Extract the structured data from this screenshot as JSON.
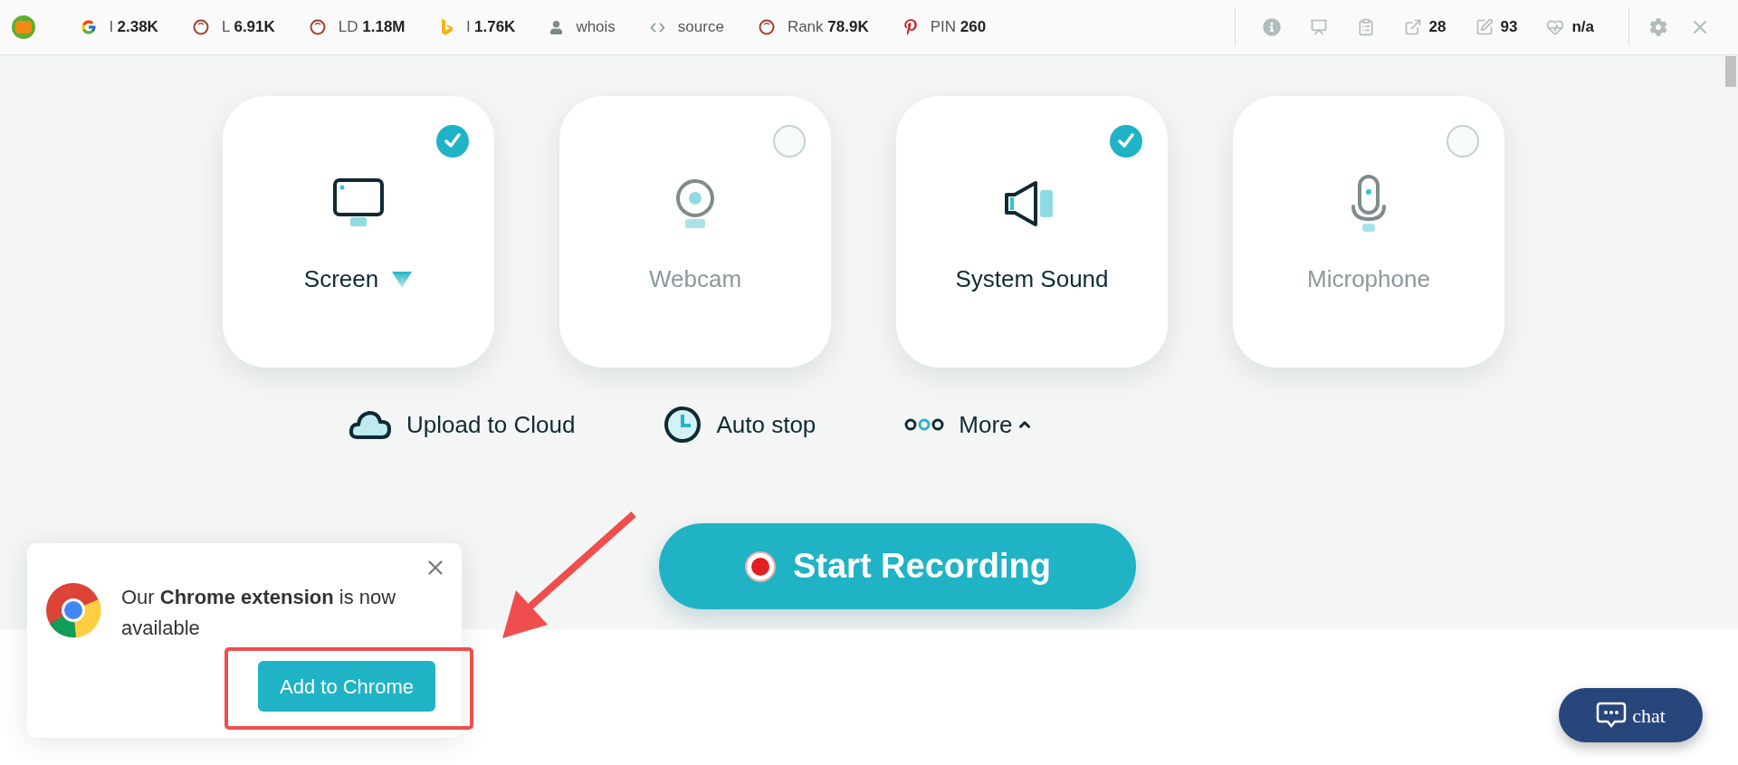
{
  "toolbar": {
    "metrics": [
      {
        "kind": "google",
        "text": "l **2.38K**"
      },
      {
        "kind": "ring",
        "text": "L **6.91K**"
      },
      {
        "kind": "ring",
        "text": "LD **1.18M**"
      },
      {
        "kind": "bing",
        "text": "l **1.76K**"
      },
      {
        "kind": "person",
        "text": "whois"
      },
      {
        "kind": "code",
        "text": "source"
      },
      {
        "kind": "ring",
        "text": "Rank **78.9K**"
      },
      {
        "kind": "pinterest",
        "text": "PIN **260**"
      }
    ],
    "stats": [
      {
        "kind": "info"
      },
      {
        "kind": "monitor"
      },
      {
        "kind": "doc"
      },
      {
        "kind": "external",
        "value": "28"
      },
      {
        "kind": "edit",
        "value": "93"
      },
      {
        "kind": "heart",
        "value": "n/a"
      }
    ]
  },
  "sources": [
    {
      "kind": "screen",
      "label": "Screen",
      "selected": true,
      "has_menu": true
    },
    {
      "kind": "webcam",
      "label": "Webcam",
      "selected": false,
      "has_menu": false
    },
    {
      "kind": "sound",
      "label": "System Sound",
      "selected": true,
      "has_menu": false
    },
    {
      "kind": "mic",
      "label": "Microphone",
      "selected": false,
      "has_menu": false
    }
  ],
  "options": [
    {
      "kind": "cloud",
      "label": "Upload to Cloud"
    },
    {
      "kind": "clock",
      "label": "Auto stop"
    },
    {
      "kind": "dots",
      "label": "More",
      "expanded": true
    }
  ],
  "start_button": "Start Recording",
  "popup": {
    "message": "Our **Chrome extension** is now available",
    "button": "Add to Chrome"
  },
  "chat": "chat"
}
